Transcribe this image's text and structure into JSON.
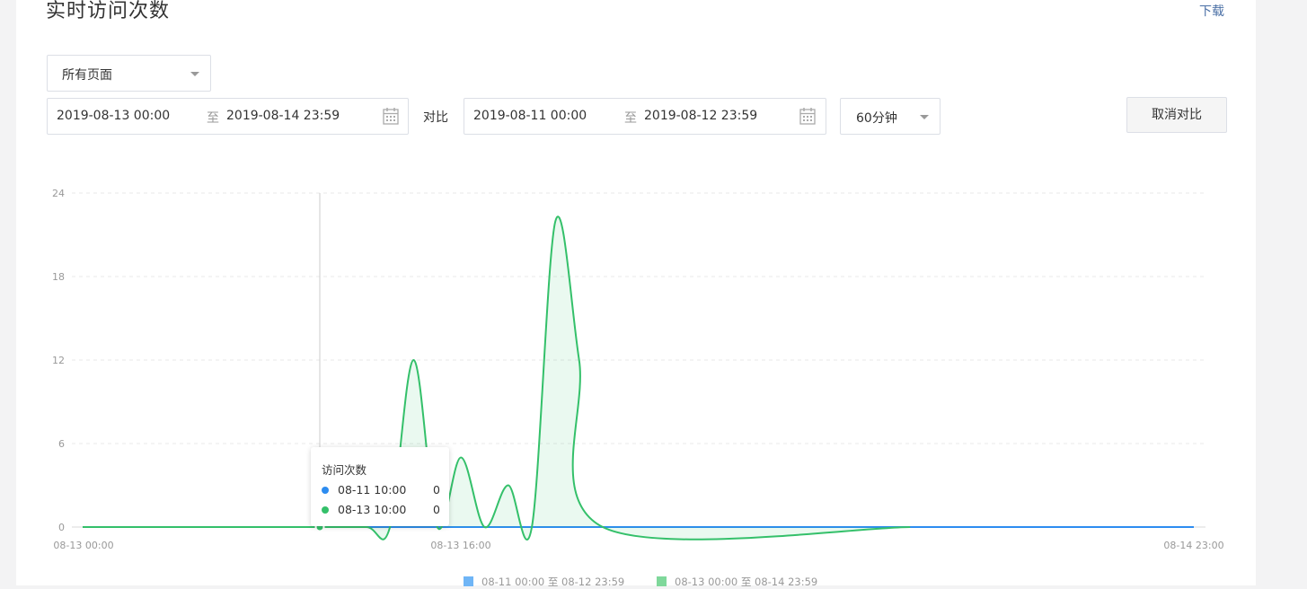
{
  "header": {
    "title": "实时访问次数",
    "download_label": "下载"
  },
  "filters": {
    "page_select": "所有页面",
    "range1": {
      "start": "2019-08-13 00:00",
      "sep": "至",
      "end": "2019-08-14 23:59"
    },
    "compare_label": "对比",
    "range2": {
      "start": "2019-08-11 00:00",
      "sep": "至",
      "end": "2019-08-12 23:59"
    },
    "interval": "60分钟",
    "cancel_compare": "取消对比"
  },
  "colors": {
    "series_a": "#2d8cf0",
    "series_b": "#34c06a",
    "grid": "#e8e8e8",
    "axis_text": "#999999"
  },
  "chart_data": {
    "type": "area",
    "ylim": [
      0,
      24
    ],
    "y_ticks": [
      "24",
      "18",
      "12",
      "6",
      "0"
    ],
    "x_tick_labels": [
      "08-13 00:00",
      "08-13 16:00",
      "08-14 23:00"
    ],
    "grid": true,
    "legend_position": "bottom",
    "series": [
      {
        "name": "08-11 00:00 至 08-12 23:59",
        "points": [
          [
            0,
            0
          ],
          [
            47,
            0
          ]
        ]
      },
      {
        "name": "08-13 00:00 至 08-14 23:59",
        "points": [
          [
            0,
            0
          ],
          [
            10,
            0
          ],
          [
            12,
            0
          ],
          [
            13,
            0
          ],
          [
            14,
            12
          ],
          [
            15,
            0
          ],
          [
            16,
            5
          ],
          [
            17,
            0
          ],
          [
            18,
            3
          ],
          [
            19,
            0
          ],
          [
            20,
            22
          ],
          [
            21,
            12
          ],
          [
            22,
            0
          ],
          [
            35,
            0
          ]
        ]
      }
    ]
  },
  "tooltip": {
    "title": "访问次数",
    "rows": [
      {
        "label": "08-11 10:00",
        "value": "0"
      },
      {
        "label": "08-13 10:00",
        "value": "0"
      }
    ]
  },
  "legend": [
    {
      "label": "08-11 00:00 至 08-12 23:59",
      "color": "#6fb5f6"
    },
    {
      "label": "08-13 00:00 至 08-14 23:59",
      "color": "#7fd89b"
    }
  ]
}
